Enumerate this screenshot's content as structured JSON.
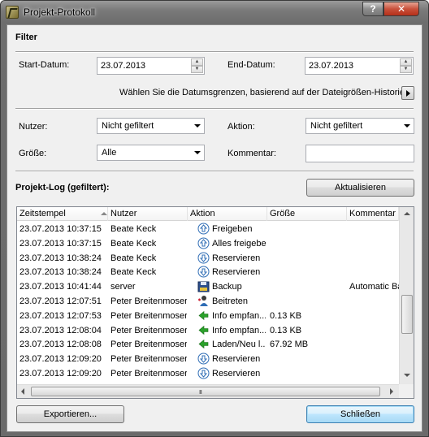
{
  "window": {
    "title": "Projekt-Protokoll",
    "help_label": "?",
    "close_label": "✕"
  },
  "filter": {
    "title": "Filter",
    "start_label": "Start-Datum:",
    "start_value": "23.07.2013",
    "end_label": "End-Datum:",
    "end_value": "23.07.2013",
    "hint": "Wählen Sie die Datumsgrenzen, basierend auf der Dateigrößen-Historie",
    "user_label": "Nutzer:",
    "user_value": "Nicht gefiltert",
    "action_label": "Aktion:",
    "action_value": "Nicht gefiltert",
    "size_label": "Größe:",
    "size_value": "Alle",
    "comment_label": "Kommentar:",
    "comment_value": ""
  },
  "log": {
    "title": "Projekt-Log (gefiltert):",
    "refresh_label": "Aktualisieren",
    "columns": [
      "Zeitstempel",
      "Nutzer",
      "Aktion",
      "Größe",
      "Kommentar"
    ],
    "rows": [
      {
        "time": "23.07.2013 10:37:15",
        "user": "Beate Keck",
        "icon": "share-up-icon",
        "action": "Freigeben",
        "size": "",
        "comment": ""
      },
      {
        "time": "23.07.2013 10:37:15",
        "user": "Beate Keck",
        "icon": "share-up-icon",
        "action": "Alles freigeben",
        "size": "",
        "comment": ""
      },
      {
        "time": "23.07.2013 10:38:24",
        "user": "Beate Keck",
        "icon": "reserve-down-icon",
        "action": "Reservieren",
        "size": "",
        "comment": ""
      },
      {
        "time": "23.07.2013 10:38:24",
        "user": "Beate Keck",
        "icon": "reserve-down-icon",
        "action": "Reservieren",
        "size": "",
        "comment": ""
      },
      {
        "time": "23.07.2013 10:41:44",
        "user": "server",
        "icon": "backup-disk-icon",
        "action": "Backup",
        "size": "",
        "comment": "Automatic Ba"
      },
      {
        "time": "23.07.2013 12:07:51",
        "user": "Peter Breitenmoser",
        "icon": "join-user-icon",
        "action": "Beitreten",
        "size": "",
        "comment": ""
      },
      {
        "time": "23.07.2013 12:07:53",
        "user": "Peter Breitenmoser",
        "icon": "green-arrow-left-icon",
        "action": "Info empfan...",
        "size": "0.13 KB",
        "comment": ""
      },
      {
        "time": "23.07.2013 12:08:04",
        "user": "Peter Breitenmoser",
        "icon": "green-arrow-left-icon",
        "action": "Info empfan...",
        "size": "0.13 KB",
        "comment": ""
      },
      {
        "time": "23.07.2013 12:08:08",
        "user": "Peter Breitenmoser",
        "icon": "green-arrow-left-icon",
        "action": "Laden/Neu l...",
        "size": "67.92 MB",
        "comment": ""
      },
      {
        "time": "23.07.2013 12:09:20",
        "user": "Peter Breitenmoser",
        "icon": "reserve-down-icon",
        "action": "Reservieren",
        "size": "",
        "comment": ""
      },
      {
        "time": "23.07.2013 12:09:20",
        "user": "Peter Breitenmoser",
        "icon": "reserve-down-icon",
        "action": "Reservieren",
        "size": "",
        "comment": ""
      }
    ]
  },
  "footer": {
    "export_label": "Exportieren...",
    "close_label": "Schließen"
  },
  "colors": {
    "accent": "#3c7fb1",
    "green_arrow": "#2aa12a",
    "blue_icon": "#2f6db5"
  }
}
